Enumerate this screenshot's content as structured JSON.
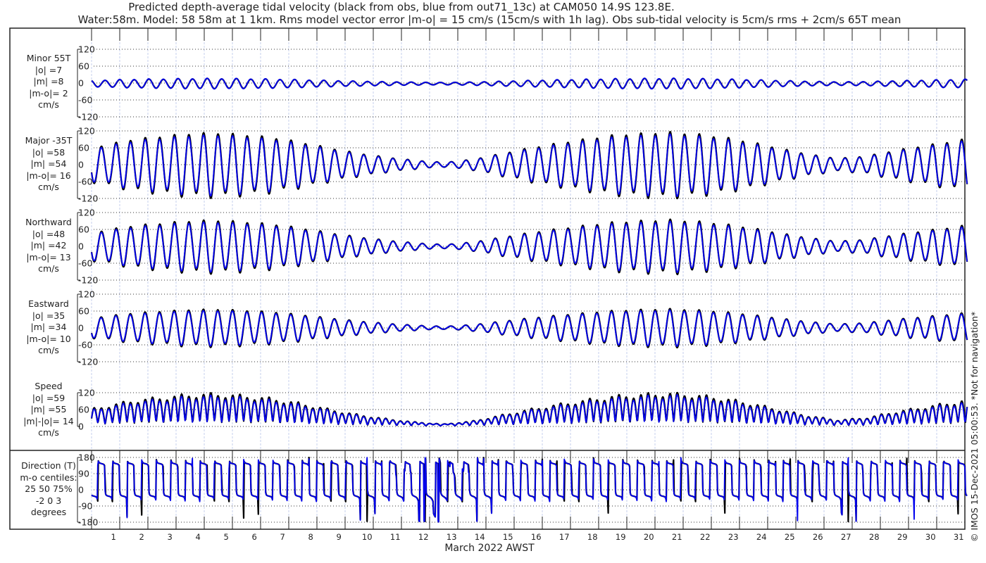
{
  "title_line1": "Predicted depth-average tidal velocity (black from obs, blue from out71_13c) at CAM050 14.9S 123.8E.",
  "title_line2": "Water:58m. Model: 58 58m at 1 1km. Rms model vector error |m-o| = 15 cm/s (15cm/s with 1h lag). Obs sub-tidal velocity is 5cm/s rms + 2cm/s 65T mean",
  "footer_note": "© IMOS 15-Dec-2021 05:00:53. *Not for navigation*",
  "colors": {
    "obs": "#000000",
    "model": "#0000ee",
    "grid_vertical": "#b8c4e8"
  },
  "chart_data": {
    "type": "line",
    "xlabel": "March 2022 AWST",
    "x_ticks": [
      "1",
      "2",
      "3",
      "4",
      "5",
      "6",
      "7",
      "8",
      "9",
      "10",
      "11",
      "12",
      "13",
      "14",
      "15",
      "16",
      "17",
      "18",
      "19",
      "20",
      "21",
      "22",
      "23",
      "24",
      "25",
      "26",
      "27",
      "28",
      "29",
      "30",
      "31"
    ],
    "xlim_days": [
      0,
      31
    ],
    "tidal_period_hours": 12.42,
    "daily_major_amplitude_obs": [
      70,
      90,
      100,
      110,
      112,
      105,
      95,
      78,
      58,
      40,
      26,
      15,
      8,
      18,
      38,
      58,
      75,
      90,
      104,
      110,
      115,
      108,
      96,
      78,
      56,
      36,
      22,
      30,
      50,
      66,
      82
    ],
    "panels": [
      {
        "id": "minor",
        "label": [
          "Minor 55T",
          "|o| =7",
          "|m| =8",
          "|m-o|= 2",
          "cm/s"
        ],
        "ylim": [
          -120,
          120
        ],
        "yticks": [
          "120",
          "60",
          "0",
          "-60",
          "-120"
        ],
        "series": [
          {
            "name": "obs"
          },
          {
            "name": "model"
          }
        ]
      },
      {
        "id": "major",
        "label": [
          "Major -35T",
          "|o| =58",
          "|m| =54",
          "|m-o|= 16",
          "cm/s"
        ],
        "ylim": [
          -120,
          120
        ],
        "yticks": [
          "120",
          "60",
          "0",
          "-60",
          "-120"
        ],
        "series": [
          {
            "name": "obs"
          },
          {
            "name": "model"
          }
        ]
      },
      {
        "id": "north",
        "label": [
          "Northward",
          "|o| =48",
          "|m| =42",
          "|m-o|= 13",
          "cm/s"
        ],
        "ylim": [
          -120,
          120
        ],
        "yticks": [
          "120",
          "60",
          "0",
          "-60",
          "-120"
        ],
        "series": [
          {
            "name": "obs"
          },
          {
            "name": "model"
          }
        ]
      },
      {
        "id": "east",
        "label": [
          "Eastward",
          "|o| =35",
          "|m| =34",
          "|m-o|= 10",
          "cm/s"
        ],
        "ylim": [
          -120,
          120
        ],
        "yticks": [
          "120",
          "60",
          "0",
          "-60",
          "-120"
        ],
        "series": [
          {
            "name": "obs"
          },
          {
            "name": "model"
          }
        ]
      },
      {
        "id": "speed",
        "label": [
          "Speed",
          "|o| =59",
          "|m| =55",
          "|m|-|o|= 14",
          "cm/s"
        ],
        "ylim": [
          0,
          120
        ],
        "yticks": [
          "120",
          "60",
          "0"
        ],
        "series": [
          {
            "name": "obs"
          },
          {
            "name": "model"
          }
        ]
      },
      {
        "id": "direction",
        "label": [
          "Direction (T)",
          "m-o centiles:",
          "25  50  75%",
          "-2  0  3",
          "degrees"
        ],
        "ylim": [
          -180,
          180
        ],
        "yticks": [
          "180",
          "90",
          "0",
          "-90",
          "-180"
        ],
        "series": [
          {
            "name": "obs"
          },
          {
            "name": "model"
          }
        ]
      }
    ]
  }
}
